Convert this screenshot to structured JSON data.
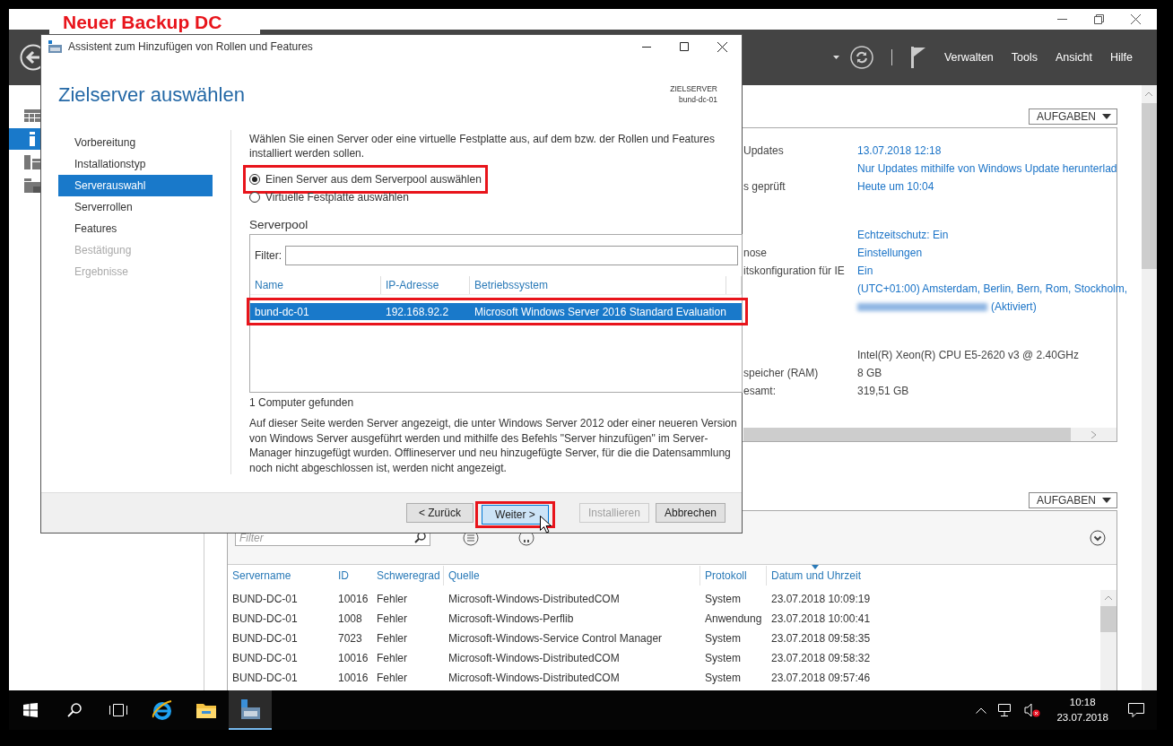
{
  "annotation_label": "Neuer Backup DC",
  "server_manager": {
    "menu": [
      "Verwalten",
      "Tools",
      "Ansicht",
      "Hilfe"
    ],
    "nav_items": [
      {
        "kind": "dashboard",
        "selected": false
      },
      {
        "kind": "local-server",
        "selected": true
      },
      {
        "kind": "all-servers",
        "selected": false
      },
      {
        "kind": "file-services",
        "selected": false
      }
    ],
    "properties": {
      "tasks_button": "AUFGABEN",
      "groups": [
        [
          {
            "label": "Updates",
            "value": "13.07.2018 12:18",
            "link": true
          },
          {
            "value": "Nur Updates mithilfe von Windows Update herunterlad",
            "link": true
          },
          {
            "label": "s geprüft",
            "value": "Heute um 10:04",
            "link": true
          }
        ],
        [
          {
            "value": "Echtzeitschutz: Ein",
            "link": true
          },
          {
            "label": "nose",
            "value": "Einstellungen",
            "link": true
          },
          {
            "label": "itskonfiguration für IE",
            "value": "Ein",
            "link": true
          },
          {
            "value": "(UTC+01:00) Amsterdam, Berlin, Bern, Rom, Stockholm,",
            "link": true
          },
          {
            "value": "(Aktiviert)",
            "link": true,
            "redacted": true
          }
        ],
        [
          {
            "value": "Intel(R) Xeon(R) CPU E5-2620 v3 @ 2.40GHz",
            "link": false
          },
          {
            "label": "speicher (RAM)",
            "value": "8 GB",
            "link": false
          },
          {
            "label": "esamt:",
            "value": "319,51 GB",
            "link": false
          }
        ]
      ]
    },
    "events": {
      "tasks_button": "AUFGABEN",
      "filter_placeholder": "Filter",
      "columns": [
        "Servername",
        "ID",
        "Schweregrad",
        "Quelle",
        "Protokoll",
        "Datum und Uhrzeit"
      ],
      "rows": [
        [
          "BUND-DC-01",
          "10016",
          "Fehler",
          "Microsoft-Windows-DistributedCOM",
          "System",
          "23.07.2018 10:09:19"
        ],
        [
          "BUND-DC-01",
          "1008",
          "Fehler",
          "Microsoft-Windows-Perflib",
          "Anwendung",
          "23.07.2018 10:00:41"
        ],
        [
          "BUND-DC-01",
          "7023",
          "Fehler",
          "Microsoft-Windows-Service Control Manager",
          "System",
          "23.07.2018 09:58:35"
        ],
        [
          "BUND-DC-01",
          "10016",
          "Fehler",
          "Microsoft-Windows-DistributedCOM",
          "System",
          "23.07.2018 09:58:32"
        ],
        [
          "BUND-DC-01",
          "10016",
          "Fehler",
          "Microsoft-Windows-DistributedCOM",
          "System",
          "23.07.2018 09:57:46"
        ]
      ]
    }
  },
  "wizard": {
    "title": "Assistent zum Hinzufügen von Rollen und Features",
    "heading": "Zielserver auswählen",
    "target_label": "ZIELSERVER",
    "target_value": "bund-dc-01",
    "steps": [
      {
        "label": "Vorbereitung",
        "selected": false,
        "disabled": false
      },
      {
        "label": "Installationstyp",
        "selected": false,
        "disabled": false
      },
      {
        "label": "Serverauswahl",
        "selected": true,
        "disabled": false
      },
      {
        "label": "Serverrollen",
        "selected": false,
        "disabled": false
      },
      {
        "label": "Features",
        "selected": false,
        "disabled": false
      },
      {
        "label": "Bestätigung",
        "selected": false,
        "disabled": true
      },
      {
        "label": "Ergebnisse",
        "selected": false,
        "disabled": true
      }
    ],
    "intro": "Wählen Sie einen Server oder eine virtuelle Festplatte aus, auf dem bzw. der Rollen und Features installiert werden sollen.",
    "options": [
      {
        "label": "Einen Server aus dem Serverpool auswählen",
        "selected": true,
        "highlighted": true
      },
      {
        "label": "Virtuelle Festplatte auswählen",
        "selected": false,
        "highlighted": false
      }
    ],
    "pool_title": "Serverpool",
    "filter_label": "Filter:",
    "columns": [
      "Name",
      "IP-Adresse",
      "Betriebssystem"
    ],
    "rows": [
      {
        "cells": [
          "bund-dc-01",
          "192.168.92.2",
          "Microsoft Windows Server 2016 Standard Evaluation"
        ],
        "selected": true,
        "highlighted": true
      }
    ],
    "count": "1 Computer gefunden",
    "note": "Auf dieser Seite werden Server angezeigt, die unter Windows Server 2012 oder einer neueren Version von Windows Server ausgeführt werden und mithilfe des Befehls \"Server hinzufügen\" im Server-Manager hinzugefügt wurden. Offlineserver und neu hinzugefügte Server, für die die Datensammlung noch nicht abgeschlossen ist, werden nicht angezeigt.",
    "buttons": [
      {
        "label": "< Zurück",
        "disabled": false,
        "focused": false,
        "highlighted": false
      },
      {
        "label": "Weiter >",
        "disabled": false,
        "focused": true,
        "highlighted": true
      },
      {
        "label": "Installieren",
        "disabled": true,
        "focused": false,
        "highlighted": false
      },
      {
        "label": "Abbrechen",
        "disabled": false,
        "focused": false,
        "highlighted": false
      }
    ]
  },
  "taskbar": {
    "pinned": [
      {
        "kind": "start",
        "selected": false
      },
      {
        "kind": "search",
        "selected": false
      },
      {
        "kind": "task-view",
        "selected": false
      },
      {
        "kind": "browser",
        "selected": false
      },
      {
        "kind": "folder",
        "selected": false
      },
      {
        "kind": "server-manager",
        "selected": true
      }
    ],
    "clock": {
      "time": "10:18",
      "date": "23.07.2018"
    }
  }
}
